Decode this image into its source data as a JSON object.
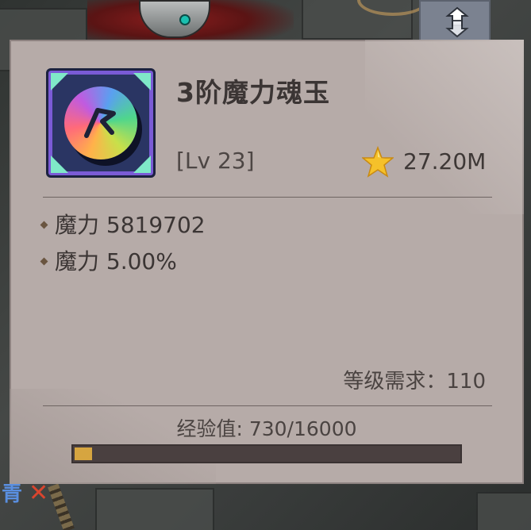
{
  "item": {
    "name": "3阶魔力魂玉",
    "level": "[Lv 23]",
    "value": "27.20M"
  },
  "stats": [
    {
      "text": "魔力 5819702"
    },
    {
      "text": "魔力 5.00%"
    }
  ],
  "requirement": "等级需求：110",
  "experience": {
    "label": "经验值: 730/16000",
    "current": 730,
    "max": 16000
  },
  "background": {
    "bottom_label": "青"
  },
  "icons": {
    "swap": "swap-arrows-icon",
    "star": "star-icon",
    "item": "soul-jade-orb-icon"
  },
  "colors": {
    "panel": "#b6aba8",
    "exp_fill": "#d6a540",
    "exp_track": "#4a4040",
    "star": "#f5c12a"
  }
}
